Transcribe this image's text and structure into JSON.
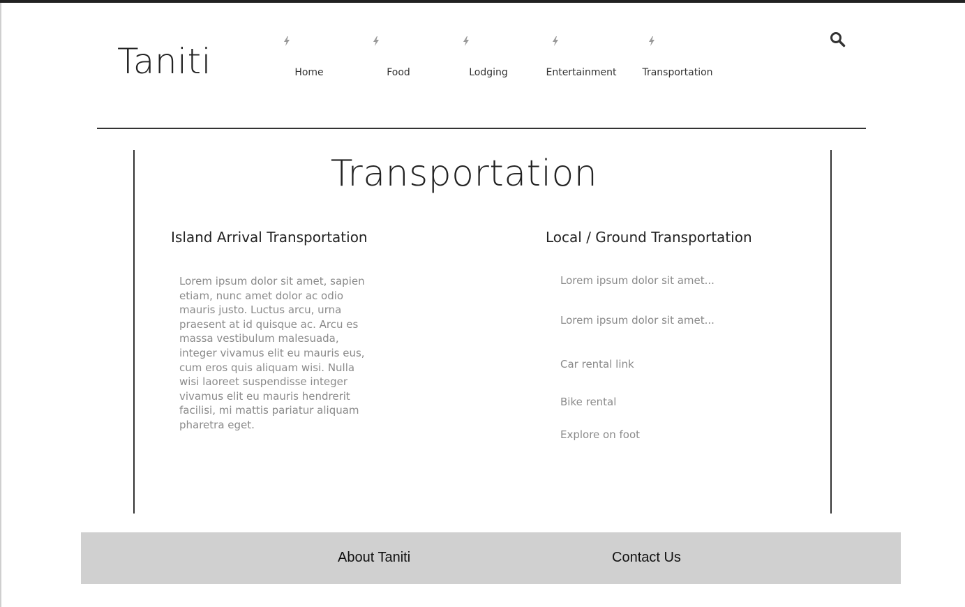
{
  "site": {
    "logo": "Taniti"
  },
  "nav": {
    "items": [
      {
        "label": "Home",
        "icon": "bolt-icon"
      },
      {
        "label": "Food",
        "icon": "bolt-icon"
      },
      {
        "label": "Lodging",
        "icon": "bolt-icon"
      },
      {
        "label": "Entertainment",
        "icon": "bolt-icon"
      },
      {
        "label": "Transportation",
        "icon": "bolt-icon"
      }
    ],
    "search_icon": "search-icon"
  },
  "main": {
    "title": "Transportation",
    "left": {
      "heading": "Island Arrival Transportation",
      "body": "Lorem ipsum dolor sit amet, sapien etiam, nunc amet dolor ac odio mauris justo. Luctus arcu, urna praesent at id quisque ac. Arcu es massa vestibulum malesuada, integer vivamus elit eu mauris eus, cum eros quis aliquam wisi. Nulla wisi laoreet suspendisse integer vivamus elit eu mauris hendrerit facilisi, mi mattis pariatur aliquam pharetra eget."
    },
    "right": {
      "heading": "Local / Ground Transportation",
      "items": [
        "Lorem ipsum dolor sit amet...",
        "Lorem ipsum dolor sit amet...",
        "Car rental link",
        "Bike rental",
        "Explore on foot"
      ]
    }
  },
  "footer": {
    "about": "About Taniti",
    "contact": "Contact Us"
  },
  "colors": {
    "text_dark": "#222222",
    "text_muted": "#8a8a8a",
    "footer_bg": "#d0d0d0",
    "icon_gray": "#9a9a9a"
  }
}
